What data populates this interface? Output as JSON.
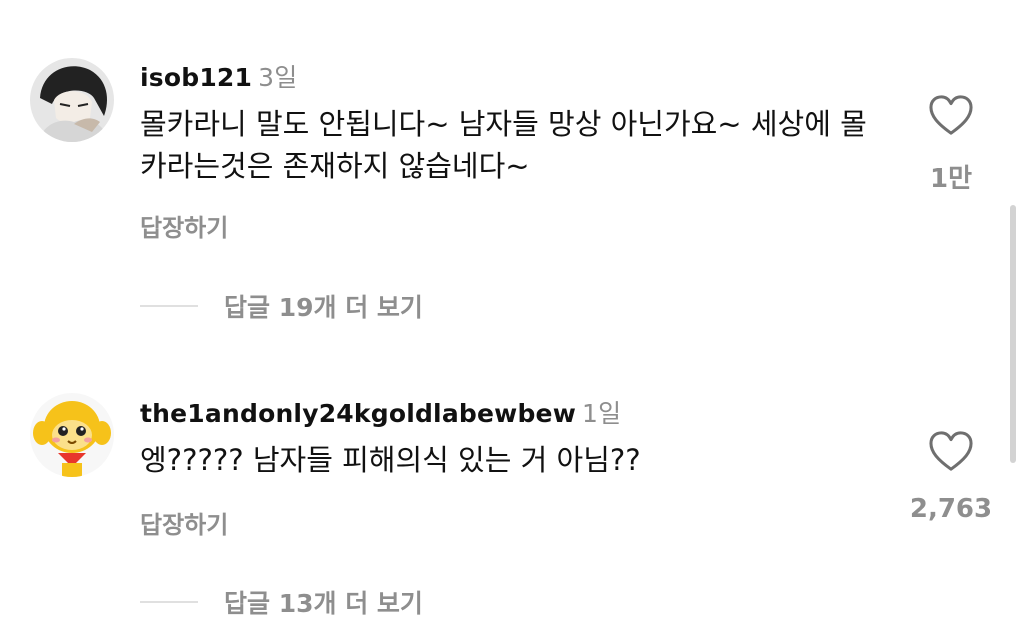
{
  "comments": [
    {
      "username": "isob121",
      "time": "3일",
      "text": "몰카라니 말도 안됩니다~ 남자들 망상 아닌가요~ 세상에 몰카라는것은 존재하지 않습네다~",
      "reply_label": "답장하기",
      "likes": "1만",
      "view_replies": "답글 19개 더 보기",
      "avatar_icon": "anime-character-avatar"
    },
    {
      "username": "the1andonly24kgoldlabewbew",
      "time": "1일",
      "text": "엥????? 남자들 피해의식 있는 거 아님??",
      "reply_label": "답장하기",
      "likes": "2,763",
      "view_replies": "답글 13개 더 보기",
      "avatar_icon": "yellow-monkey-avatar"
    }
  ],
  "icons": {
    "like": "heart-outline-icon"
  },
  "colors": {
    "secondary_text": "#8e8e8e",
    "primary_text": "#111111",
    "divider": "#e0e0e0"
  }
}
